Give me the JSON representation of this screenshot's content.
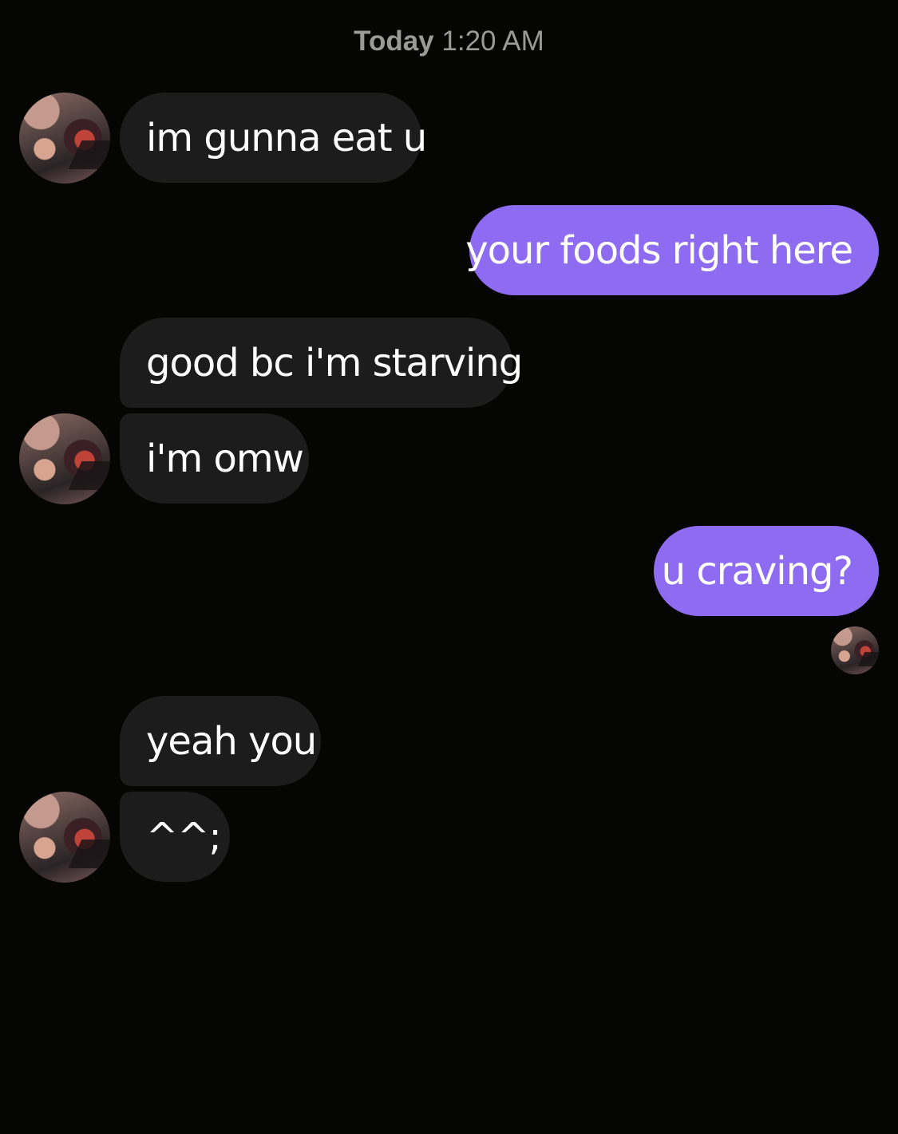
{
  "header": {
    "day": "Today",
    "time": "1:20 AM"
  },
  "messages": [
    {
      "sender": "them",
      "text": "im gunna eat u"
    },
    {
      "sender": "me",
      "text": "your foods right here"
    },
    {
      "sender": "them",
      "text": "good bc i'm starving"
    },
    {
      "sender": "them",
      "text": "i'm omw"
    },
    {
      "sender": "me",
      "text": "u craving?"
    },
    {
      "sender": "them",
      "text": "yeah you"
    },
    {
      "sender": "them",
      "text": "^^;"
    }
  ],
  "colors": {
    "background": "#050503",
    "incoming_bubble": "#1c1c1c",
    "outgoing_bubble": "#8e6cf2",
    "timestamp": "#9a9a9a"
  },
  "icons": {
    "avatar": "contact-avatar-photo",
    "read_receipt": "read-receipt-avatar"
  }
}
